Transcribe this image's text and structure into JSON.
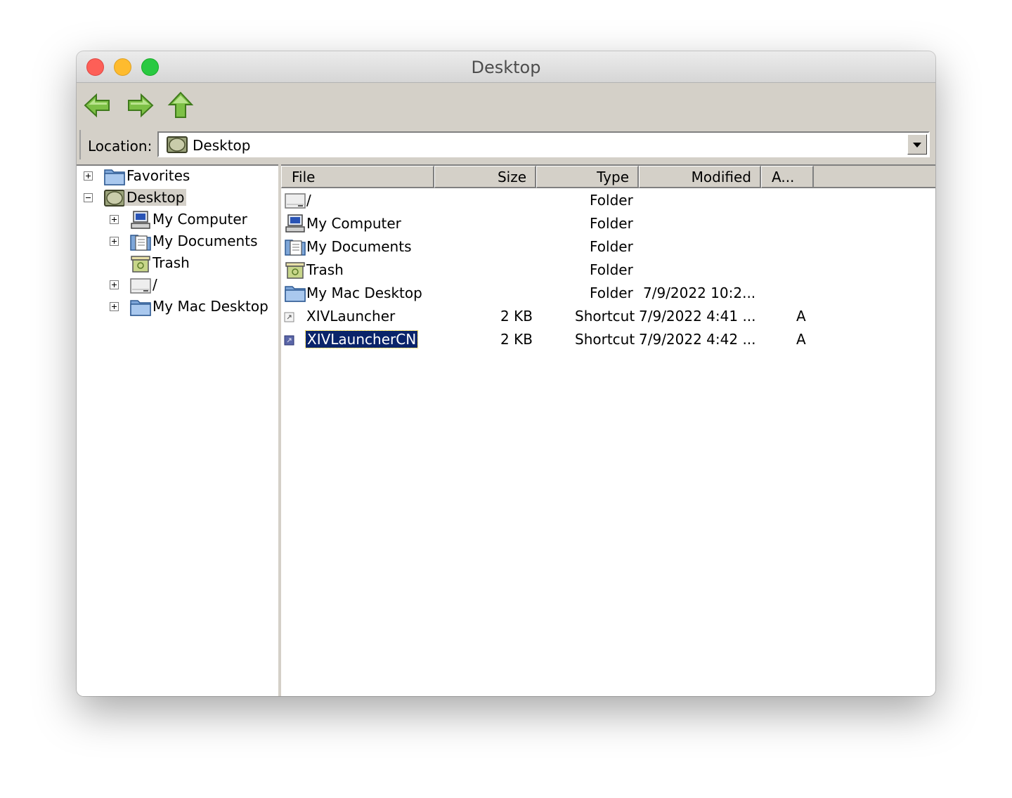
{
  "window": {
    "title": "Desktop"
  },
  "toolbar": {
    "back_icon": "back-arrow-icon",
    "forward_icon": "forward-arrow-icon",
    "up_icon": "up-arrow-icon"
  },
  "location": {
    "label": "Location:",
    "value": "Desktop"
  },
  "tree": {
    "items": [
      {
        "label": "Favorites",
        "icon": "folder-icon",
        "expander": "plus"
      },
      {
        "label": "Desktop",
        "icon": "desktop-icon",
        "expander": "minus"
      },
      {
        "label": "My Computer",
        "icon": "computer-icon",
        "expander": "plus"
      },
      {
        "label": "My Documents",
        "icon": "documents-icon",
        "expander": "plus"
      },
      {
        "label": "Trash",
        "icon": "trash-icon",
        "expander": ""
      },
      {
        "label": "/",
        "icon": "drive-icon",
        "expander": "plus"
      },
      {
        "label": "My Mac Desktop",
        "icon": "folder-icon",
        "expander": "plus"
      }
    ]
  },
  "list": {
    "columns": [
      "File",
      "Size",
      "Type",
      "Modified",
      "A..."
    ],
    "rows": [
      {
        "name": "/",
        "size": "",
        "type": "Folder",
        "modified": "",
        "attr": "",
        "icon": "drive-icon"
      },
      {
        "name": "My Computer",
        "size": "",
        "type": "Folder",
        "modified": "",
        "attr": "",
        "icon": "computer-icon"
      },
      {
        "name": "My Documents",
        "size": "",
        "type": "Folder",
        "modified": "",
        "attr": "",
        "icon": "documents-icon"
      },
      {
        "name": "Trash",
        "size": "",
        "type": "Folder",
        "modified": "",
        "attr": "",
        "icon": "trash-icon"
      },
      {
        "name": "My Mac Desktop",
        "size": "",
        "type": "Folder",
        "modified": "7/9/2022 10:2...",
        "attr": "",
        "icon": "folder-icon"
      },
      {
        "name": "XIVLauncher",
        "size": "2 KB",
        "type": "Shortcut",
        "modified": "7/9/2022 4:41 ...",
        "attr": "A",
        "icon": "shortcut-icon"
      },
      {
        "name": "XIVLauncherCN",
        "size": "2 KB",
        "type": "Shortcut",
        "modified": "7/9/2022 4:42 ...",
        "attr": "A",
        "icon": "shortcut-icon",
        "selected": true
      }
    ]
  },
  "colors": {
    "selection": "#0a246a",
    "chrome": "#d4d0c8",
    "arrow_green": "#6cb33f"
  }
}
